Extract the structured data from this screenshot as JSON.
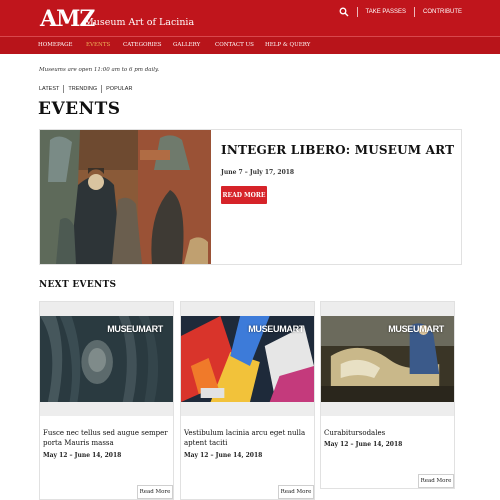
{
  "brand": {
    "logo": "AMZ",
    "name": "Museum Art of Lacinia",
    "primary_color": "#c0151c",
    "accent_color": "#f0b35a"
  },
  "top_actions": {
    "search_icon": "search-icon",
    "take_passes": "TAKE PASSES",
    "contribute": "CONTRIBUTE"
  },
  "nav": [
    {
      "label": "HOMEPAGE",
      "active": false
    },
    {
      "label": "EVENTS",
      "active": true
    },
    {
      "label": "CATEGORIES",
      "active": false
    },
    {
      "label": "GALLERY",
      "active": false
    },
    {
      "label": "CONTACT US",
      "active": false
    },
    {
      "label": "HELP & QUERY",
      "active": false
    }
  ],
  "hours": "Museums are open 11:00 am to 6 pm daily.",
  "filters": [
    "LATEST",
    "TRENDING",
    "POPULAR"
  ],
  "page_title": "EVENTS",
  "featured": {
    "title": "INTEGER LIBERO: MUSEUM ART",
    "date": "June 7 – July 17, 2018",
    "button": "READ MORE"
  },
  "next_events_title": "NEXT EVENTS",
  "cards": [
    {
      "image_label": "MUSEUMART",
      "title": "Fusce nec tellus sed augue semper porta Mauris massa",
      "date": "May 12 – June 14, 2018",
      "button": "Read More"
    },
    {
      "image_label": "MUSEUMART",
      "title": "Vestibulum lacinia arcu eget nulla aptent taciti",
      "date": "May 12 – June 14, 2018",
      "button": "Read More"
    },
    {
      "image_label": "MUSEUMART",
      "title": "Curabitursodales",
      "date": "May 12 – June 14, 2018",
      "button": "Read More"
    }
  ]
}
